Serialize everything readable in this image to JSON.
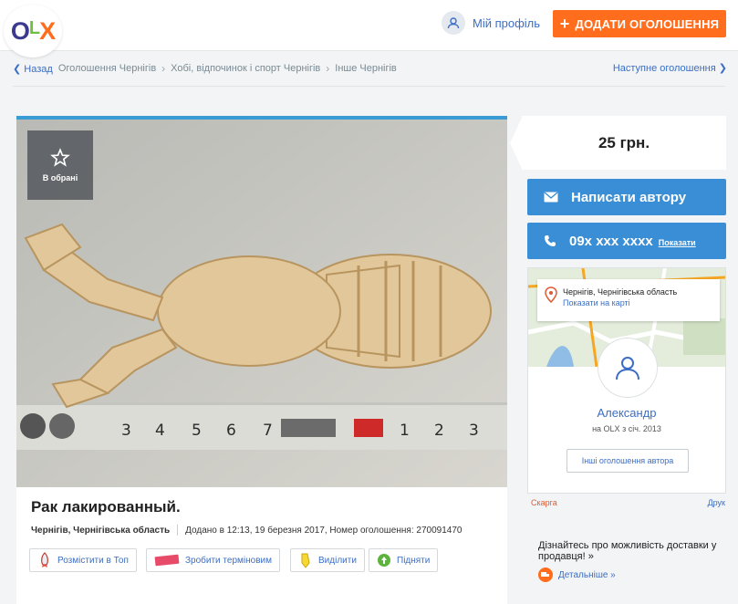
{
  "header": {
    "logo": "OLX",
    "profile_label": "Мій профіль",
    "add_button_label": "ДОДАТИ ОГОЛОШЕННЯ"
  },
  "breadcrumb": {
    "back": "Назад",
    "items": [
      "Оголошення Чернігів",
      "Хобі, відпочинок і спорт Чернігів",
      "Інше Чернігів"
    ],
    "next": "Наступне оголошення"
  },
  "listing": {
    "favorite_label": "В обрані",
    "title": "Рак лакированный.",
    "location": "Чернігів, Чернігівська область",
    "added": "Додано в 12:13, 19 березня 2017, Номер оголошення: 270091470",
    "promo": {
      "top": "Розмістити в Топ",
      "urgent": "Зробити терміновим",
      "highlight": "Виділити",
      "raise": "Підняти"
    }
  },
  "sidebar": {
    "price": "25 грн.",
    "write_author": "Написати автору",
    "phone": "09x xxx xxxx",
    "show_phone": "Показати",
    "map_location": "Чернігів, Чернігівська область",
    "show_on_map": "Показати на карті",
    "author_name": "Александр",
    "author_since": "на OLX з січ. 2013",
    "other_ads": "Інші оголошення автора",
    "report": "Скарга",
    "print": "Друк",
    "delivery_text": "Дізнайтесь про можливість доставки у продавця! »",
    "delivery_more": "Детальніше »"
  },
  "colors": {
    "accent_orange": "#ff6d1d",
    "link_blue": "#3b6ec4",
    "button_blue": "#3a8ed6"
  }
}
